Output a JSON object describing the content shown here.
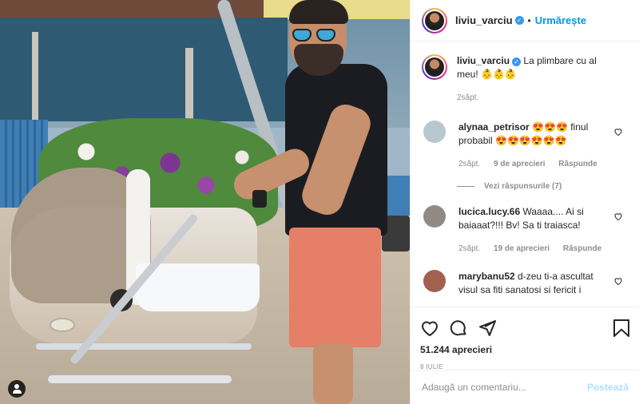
{
  "post": {
    "author": "liviu_varciu",
    "follow_label": "Urmărește",
    "dot": "•",
    "caption": "La plimbare cu al meu! 👶👶👶",
    "caption_time": "2săpt."
  },
  "comments": [
    {
      "username": "alynaa_petrisor",
      "text": "😍😍😍 finul probabil 😍😍😍😍😍😍",
      "time": "2săpt.",
      "likes": "9 de aprecieri",
      "reply_label": "Răspunde",
      "view_replies": "Vezi răspunsurile (7)",
      "avatar_color": "#b9c7cf"
    },
    {
      "username": "lucica.lucy.66",
      "text": "Waaaa.... Ai si baiaaat?!!! Bv! Sa ti traiasca!",
      "time": "2săpt.",
      "likes": "19 de aprecieri",
      "reply_label": "Răspunde",
      "avatar_color": "#8f8a86"
    },
    {
      "username": "marybanu52",
      "text": "d-zeu ti-a ascultat visul sa fiti sanatosi si fericit i",
      "avatar_color": "#a0614f"
    }
  ],
  "actions": {
    "like_icon": "heart-icon",
    "comment_icon": "comment-icon",
    "share_icon": "paper-plane-icon",
    "save_icon": "bookmark-icon"
  },
  "stats": {
    "likes": "51.244 aprecieri",
    "date": "8 IULIE"
  },
  "composer": {
    "placeholder": "Adaugă un comentariu...",
    "post_label": "Postează"
  },
  "colors": {
    "link": "#0095f6",
    "verified": "#3897f0",
    "muted": "#8e8e8e",
    "post_disabled": "#b2dffc"
  }
}
